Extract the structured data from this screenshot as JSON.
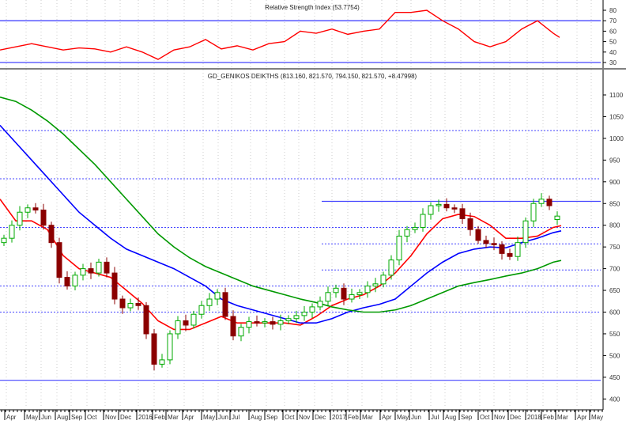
{
  "chart_data": [
    {
      "type": "line",
      "title": "Relative Strength Index (53.7754)",
      "ylim": [
        25,
        85
      ],
      "yticks": [
        30,
        40,
        50,
        60,
        70,
        80
      ],
      "reference_lines": [
        70,
        30
      ],
      "series": [
        {
          "name": "RSI",
          "color": "#ff0000",
          "values": [
            42,
            45,
            48,
            45,
            42,
            44,
            43,
            40,
            45,
            40,
            33,
            42,
            45,
            52,
            43,
            46,
            42,
            48,
            50,
            60,
            58,
            62,
            57,
            60,
            62,
            78,
            78,
            80,
            70,
            62,
            50,
            45,
            50,
            62,
            70,
            58,
            54
          ]
        }
      ]
    },
    {
      "type": "candlestick",
      "title": "GD_GENIKOS DEIKTHS (813.160, 821.570, 794.150, 821.570, +8.47998)",
      "ylim": [
        380,
        1130
      ],
      "yticks": [
        400,
        450,
        500,
        550,
        600,
        650,
        700,
        750,
        800,
        850,
        900,
        950,
        1000,
        1050,
        1100
      ],
      "xticks": [
        "Apr",
        "May",
        "Jun",
        "Aug",
        "Sep",
        "Oct",
        "Nov",
        "Dec",
        "2016",
        "Feb",
        "Mar",
        "Apr",
        "May",
        "Jun",
        "Jul",
        "Aug",
        "Sep",
        "Oct",
        "Nov",
        "Dec",
        "2017",
        "Feb",
        "Mar",
        "Apr",
        "May",
        "Jun",
        "Jul",
        "Aug",
        "Sep",
        "Oct",
        "Nov",
        "Dec",
        "2018",
        "Feb",
        "Mar",
        "Apr",
        "May"
      ],
      "closes": [
        770,
        800,
        830,
        840,
        835,
        800,
        760,
        680,
        660,
        685,
        700,
        690,
        715,
        690,
        630,
        610,
        620,
        615,
        550,
        480,
        490,
        550,
        580,
        570,
        595,
        615,
        630,
        645,
        590,
        545,
        565,
        578,
        575,
        578,
        572,
        580,
        585,
        592,
        600,
        612,
        625,
        645,
        655,
        630,
        640,
        645,
        660,
        665,
        685,
        720,
        775,
        790,
        795,
        825,
        845,
        848,
        840,
        838,
        815,
        790,
        765,
        758,
        755,
        735,
        728,
        760,
        810,
        850,
        860,
        845,
        821
      ],
      "last_open": 813.16,
      "moving_averages": [
        {
          "name": "short MA",
          "color": "#ff0000",
          "values": [
            860,
            810,
            810,
            790,
            730,
            700,
            690,
            680,
            650,
            620,
            580,
            560,
            560,
            575,
            590,
            575,
            575,
            575,
            575,
            570,
            590,
            615,
            630,
            640,
            660,
            690,
            730,
            780,
            815,
            825,
            820,
            800,
            770,
            770,
            775,
            795
          ]
        },
        {
          "name": "medium MA",
          "color": "#0000ff",
          "values": [
            1030,
            990,
            950,
            910,
            870,
            830,
            800,
            770,
            745,
            730,
            715,
            700,
            680,
            660,
            630,
            615,
            605,
            595,
            585,
            575,
            575,
            585,
            600,
            610,
            618,
            630,
            660,
            690,
            715,
            735,
            745,
            750,
            748,
            760,
            770,
            783
          ]
        },
        {
          "name": "long MA",
          "color": "#009900",
          "values": [
            1095,
            1085,
            1065,
            1040,
            1010,
            975,
            940,
            900,
            860,
            820,
            780,
            750,
            725,
            705,
            690,
            675,
            660,
            650,
            640,
            630,
            622,
            612,
            605,
            600,
            600,
            605,
            615,
            630,
            645,
            660,
            668,
            675,
            683,
            690,
            700,
            715
          ]
        }
      ],
      "support_resistance_solid": [
        855,
        443
      ],
      "dotted_levels": [
        1018,
        907,
        795,
        757,
        697,
        660,
        600
      ]
    }
  ],
  "colors": {
    "up": "#00aa00",
    "down": "#8b0000",
    "level": "#4444ff"
  }
}
